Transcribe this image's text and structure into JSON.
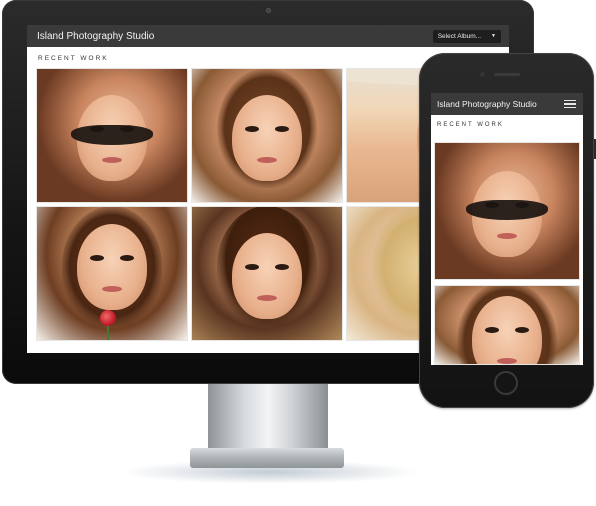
{
  "site": {
    "title": "Island Photography Studio",
    "section_heading": "RECENT WORK"
  },
  "desktop": {
    "album_select": {
      "selected": "Select Album...",
      "caret": "▼"
    },
    "photos": [
      {
        "name": "portrait-sunglasses"
      },
      {
        "name": "portrait-curly-hair"
      },
      {
        "name": "portrait-hat"
      },
      {
        "name": "portrait-rose"
      },
      {
        "name": "portrait-straight-hair"
      },
      {
        "name": "portrait-blonde"
      }
    ]
  },
  "mobile": {
    "menu_icon": "hamburger-menu-icon",
    "photos": [
      {
        "name": "portrait-sunglasses"
      },
      {
        "name": "portrait-curly-hair"
      }
    ]
  },
  "colors": {
    "header_bg": "#3a3a3a",
    "header_text": "#f2f2f2",
    "page_bg": "#ffffff",
    "device_frame": "#1a1a1a"
  }
}
